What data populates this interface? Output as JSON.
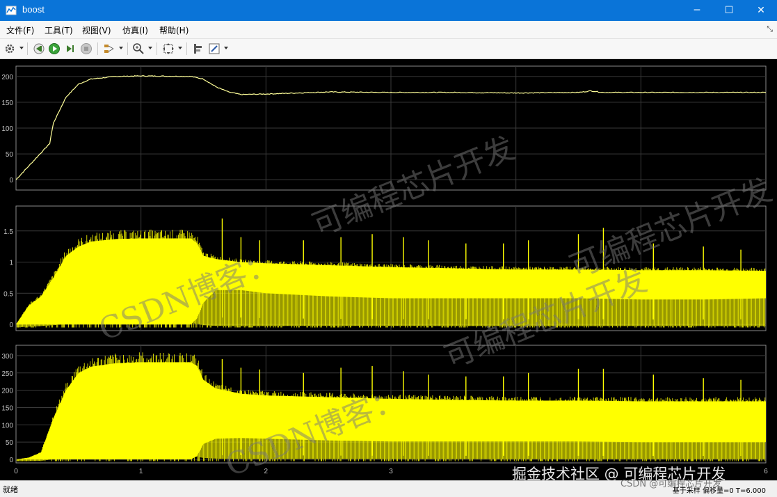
{
  "window": {
    "title": "boost"
  },
  "window_controls": {
    "minimize": "─",
    "maximize": "☐",
    "close": "✕"
  },
  "menu": {
    "items": [
      "文件(F)",
      "工具(T)",
      "视图(V)",
      "仿真(I)",
      "帮助(H)"
    ],
    "right_glyph": "⤡"
  },
  "toolbar": {
    "icons": [
      "settings-icon",
      "step-back-icon",
      "run-icon",
      "step-forward-icon",
      "stop-icon",
      "signal-selector-icon",
      "zoom-icon",
      "autoscale-icon",
      "cursor-measure-icon",
      "style-icon"
    ]
  },
  "status": {
    "left": "就绪",
    "right": "基于采样 偏移量=0 T=6.000"
  },
  "watermarks": {
    "main": [
      "可编程芯片开发",
      "CSDN博客：",
      "可编程芯片开发",
      "CSDN博客：",
      "可编程芯片开发"
    ],
    "footer": "掘金技术社区 @ 可编程芯片开发",
    "footer2": "CSDN @可编程芯片开发"
  },
  "colors": {
    "signal": "#ffff00",
    "background": "#000000",
    "grid": "#3a3a3a",
    "axis_text": "#c0c0c0",
    "titlebar": "#0a74d8"
  },
  "chart_data": [
    {
      "type": "line",
      "xlim": [
        0,
        6
      ],
      "ylim": [
        -20,
        220
      ],
      "yticks": [
        0,
        50,
        100,
        150,
        200
      ],
      "x": [
        0,
        0.25,
        0.27,
        0.28,
        0.3,
        0.4,
        0.5,
        0.6,
        0.8,
        1.0,
        1.4,
        1.5,
        1.6,
        1.7,
        1.8,
        2.0,
        2.5,
        3.0,
        3.5,
        4.0,
        4.5,
        4.6,
        4.7,
        5.0,
        5.5,
        6.0
      ],
      "values": [
        0,
        65,
        70,
        85,
        110,
        160,
        185,
        195,
        200,
        201,
        200,
        195,
        180,
        170,
        165,
        166,
        170,
        169,
        169,
        168,
        169,
        172,
        169,
        169,
        169,
        169
      ]
    },
    {
      "type": "area",
      "xlim": [
        0,
        6
      ],
      "ylim": [
        -0.1,
        1.9
      ],
      "yticks": [
        0,
        0.5,
        1,
        1.5
      ],
      "x": [
        0,
        0.1,
        0.2,
        0.3,
        0.4,
        0.5,
        0.6,
        0.8,
        1.0,
        1.4,
        1.45,
        1.5,
        1.6,
        1.8,
        2.0,
        2.5,
        3.0,
        3.5,
        4.0,
        4.5,
        5.0,
        5.5,
        6.0
      ],
      "upper": [
        0,
        0.3,
        0.45,
        0.75,
        1.1,
        1.25,
        1.33,
        1.37,
        1.38,
        1.38,
        1.3,
        1.1,
        1.05,
        1.0,
        0.98,
        0.95,
        0.92,
        0.9,
        0.88,
        0.88,
        0.87,
        0.87,
        0.86
      ],
      "lower": [
        0,
        0,
        0,
        0,
        0,
        0,
        0,
        0,
        0,
        0,
        0.1,
        0.35,
        0.55,
        0.55,
        0.5,
        0.45,
        0.42,
        0.42,
        0.42,
        0.42,
        0.4,
        0.4,
        0.42
      ],
      "spikes": [
        [
          1.65,
          1.7
        ],
        [
          1.8,
          1.4
        ],
        [
          1.95,
          1.35
        ],
        [
          2.3,
          1.35
        ],
        [
          2.6,
          1.4
        ],
        [
          2.85,
          1.45
        ],
        [
          3.1,
          1.4
        ],
        [
          3.3,
          1.35
        ],
        [
          3.6,
          1.3
        ],
        [
          3.9,
          1.3
        ],
        [
          4.1,
          1.35
        ],
        [
          4.5,
          1.45
        ],
        [
          4.7,
          1.55
        ],
        [
          5.1,
          1.3
        ],
        [
          5.5,
          1.25
        ],
        [
          5.8,
          1.2
        ]
      ]
    },
    {
      "type": "area",
      "xlim": [
        0,
        6
      ],
      "ylim": [
        -10,
        330
      ],
      "yticks": [
        0,
        50,
        100,
        150,
        200,
        250,
        300
      ],
      "x": [
        0,
        0.1,
        0.2,
        0.3,
        0.4,
        0.5,
        0.6,
        0.8,
        1.0,
        1.4,
        1.45,
        1.5,
        1.6,
        1.8,
        2.0,
        2.5,
        3.0,
        3.5,
        4.0,
        4.5,
        5.0,
        5.5,
        6.0
      ],
      "upper": [
        0,
        5,
        20,
        120,
        200,
        250,
        268,
        278,
        281,
        281,
        270,
        230,
        205,
        190,
        185,
        180,
        175,
        172,
        170,
        170,
        168,
        168,
        168
      ],
      "lower": [
        0,
        0,
        0,
        0,
        0,
        0,
        0,
        0,
        0,
        0,
        10,
        45,
        60,
        62,
        60,
        55,
        52,
        52,
        52,
        52,
        50,
        50,
        50
      ],
      "spikes": [
        [
          1.65,
          290
        ],
        [
          1.8,
          265
        ],
        [
          1.95,
          260
        ],
        [
          2.3,
          250
        ],
        [
          2.6,
          265
        ],
        [
          2.85,
          270
        ],
        [
          3.1,
          255
        ],
        [
          3.3,
          245
        ],
        [
          3.6,
          240
        ],
        [
          3.9,
          240
        ],
        [
          4.1,
          250
        ],
        [
          4.5,
          262
        ],
        [
          4.7,
          262
        ],
        [
          5.1,
          245
        ],
        [
          5.5,
          235
        ],
        [
          5.8,
          230
        ]
      ]
    }
  ],
  "x_axis_ticks": [
    "0",
    "1",
    "2",
    "3",
    "4",
    "5",
    "6"
  ]
}
